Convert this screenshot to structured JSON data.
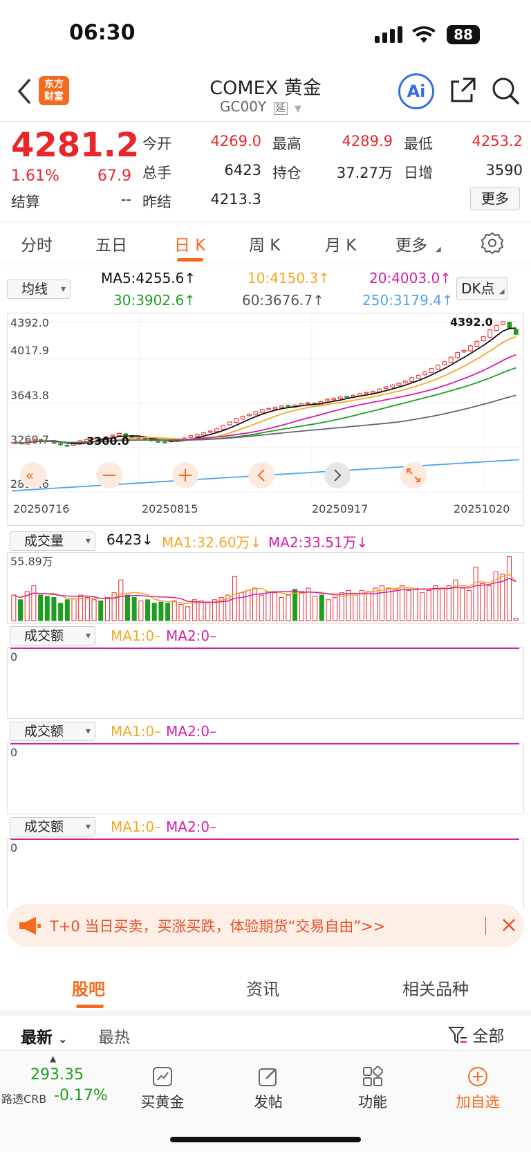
{
  "status_bar": {
    "time": "06:30",
    "battery": "88"
  },
  "header": {
    "logo_line1": "东方",
    "logo_line2": "财富",
    "title": "COMEX 黄金",
    "code": "GC00Y",
    "code_badge": "延",
    "ai_label": "Ai"
  },
  "quote": {
    "price": "4281.2",
    "pct": "1.61%",
    "chg": "67.9",
    "open_label": "今开",
    "open": "4269.0",
    "high_label": "最高",
    "high": "4289.9",
    "low_label": "最低",
    "low": "4253.2",
    "vol_label": "总手",
    "vol": "6423",
    "oi_label": "持仓",
    "oi": "37.27万",
    "inc_label": "日增",
    "inc": "3590",
    "settle_label": "结算",
    "settle": "--",
    "prev_label": "昨结",
    "prev": "4213.3",
    "more": "更多"
  },
  "tabs": [
    {
      "label": "分时"
    },
    {
      "label": "五日"
    },
    {
      "label": "日 K"
    },
    {
      "label": "周 K"
    },
    {
      "label": "月 K"
    },
    {
      "label": "更多"
    }
  ],
  "ma_bar": {
    "selector": "均线",
    "ma5": "MA5:4255.6↑",
    "ma10": "10:4150.3↑",
    "ma20": "20:4003.0↑",
    "ma30": "30:3902.6↑",
    "ma60": "60:3676.7↑",
    "ma250": "250:3179.4↑",
    "dk": "DK点"
  },
  "colors": {
    "up": "#e8262b",
    "down": "#1f9d1f",
    "ma5": "#111111",
    "ma10": "#f6a623",
    "ma20": "#d51ea6",
    "ma30": "#1f9d1f",
    "ma60": "#666666",
    "ma250": "#4aa3f0",
    "accent": "#f56a1c"
  },
  "chart_data": {
    "type": "candlestick",
    "y_ticks": [
      "4392.0",
      "4017.9",
      "3643.8",
      "3269.7",
      "2895.6"
    ],
    "x_ticks": [
      "20250716",
      "20250815",
      "20250917",
      "20251020"
    ],
    "high_marker": "4392.0",
    "low_marker": "3300.0",
    "closes": [
      3330,
      3320,
      3345,
      3360,
      3350,
      3340,
      3325,
      3310,
      3300,
      3320,
      3345,
      3355,
      3368,
      3360,
      3380,
      3395,
      3410,
      3385,
      3370,
      3375,
      3355,
      3345,
      3340,
      3330,
      3345,
      3355,
      3370,
      3390,
      3400,
      3415,
      3430,
      3450,
      3480,
      3510,
      3540,
      3560,
      3580,
      3600,
      3620,
      3630,
      3640,
      3650,
      3645,
      3660,
      3670,
      3680,
      3665,
      3690,
      3710,
      3720,
      3730,
      3735,
      3745,
      3760,
      3770,
      3780,
      3800,
      3820,
      3835,
      3850,
      3870,
      3900,
      3920,
      3950,
      3980,
      4010,
      4040,
      4080,
      4120,
      4140,
      4180,
      4220,
      4260,
      4320,
      4360,
      4392,
      4330,
      4281
    ],
    "ma_lines": [
      "MA5",
      "MA10",
      "MA20",
      "MA30",
      "MA60",
      "MA250"
    ]
  },
  "volume": {
    "selector": "成交量",
    "value": "6423↓",
    "ma1": "MA1:32.60万↓",
    "ma2": "MA2:33.51万↓",
    "max_label": "55.89万",
    "bars": [
      22,
      18,
      25,
      30,
      22,
      21,
      20,
      15,
      18,
      19,
      22,
      20,
      18,
      17,
      20,
      24,
      35,
      22,
      20,
      17,
      18,
      15,
      16,
      15,
      17,
      14,
      12,
      18,
      17,
      16,
      18,
      20,
      22,
      38,
      24,
      26,
      28,
      22,
      25,
      24,
      20,
      22,
      27,
      25,
      28,
      21,
      22,
      18,
      20,
      24,
      26,
      22,
      26,
      25,
      28,
      30,
      28,
      27,
      30,
      26,
      28,
      24,
      26,
      30,
      28,
      30,
      35,
      28,
      26,
      46,
      32,
      30,
      42,
      40,
      55,
      2
    ]
  },
  "amount_panels": [
    {
      "selector": "成交额",
      "ma1": "MA1:0–",
      "ma2": "MA2:0–",
      "zero": "0"
    },
    {
      "selector": "成交额",
      "ma1": "MA1:0–",
      "ma2": "MA2:0–",
      "zero": "0"
    },
    {
      "selector": "成交额",
      "ma1": "MA1:0–",
      "ma2": "MA2:0–",
      "zero": "0"
    }
  ],
  "banner": {
    "text": "T+0 当日买卖，买涨买跌，体验期货“交易自由”>>"
  },
  "bottom_tabs": [
    {
      "label": "股吧"
    },
    {
      "label": "资讯"
    },
    {
      "label": "相关品种"
    }
  ],
  "sort": {
    "latest": "最新",
    "hot": "最热",
    "all": "全部"
  },
  "toolbar": {
    "crb_value": "293.35",
    "crb_name": "路透CRB",
    "crb_pct": "-0.17%",
    "buy_gold": "买黄金",
    "post": "发帖",
    "func": "功能",
    "add": "加自选"
  }
}
